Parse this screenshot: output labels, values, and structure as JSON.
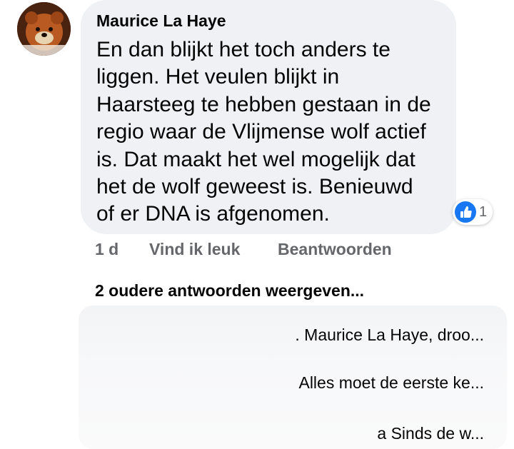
{
  "comment": {
    "author": "Maurice La Haye",
    "text_lines": [
      "En dan blijkt het toch anders te",
      "liggen. Het veulen blijkt in",
      "Haarsteeg te hebben gestaan in de",
      "regio waar de Vlijmense wolf actief",
      "is. Dat maakt het wel mogelijk dat",
      "het de wolf geweest is. Benieuwd",
      "of er DNA is afgenomen."
    ],
    "reaction": {
      "icon": "thumbs-up-icon",
      "count": "1",
      "color": "#1877f2"
    },
    "time": "1 d",
    "like_label": "Vind ik leuk",
    "reply_label": "Beantwoorden"
  },
  "more_replies": {
    "label": "2 oudere antwoorden weergeven...",
    "previews": [
      ". Maurice La Haye, droo...",
      "Alles moet de eerste ke...",
      "a Sinds de w..."
    ]
  },
  "avatar": {
    "icon": "avatar-icon"
  }
}
